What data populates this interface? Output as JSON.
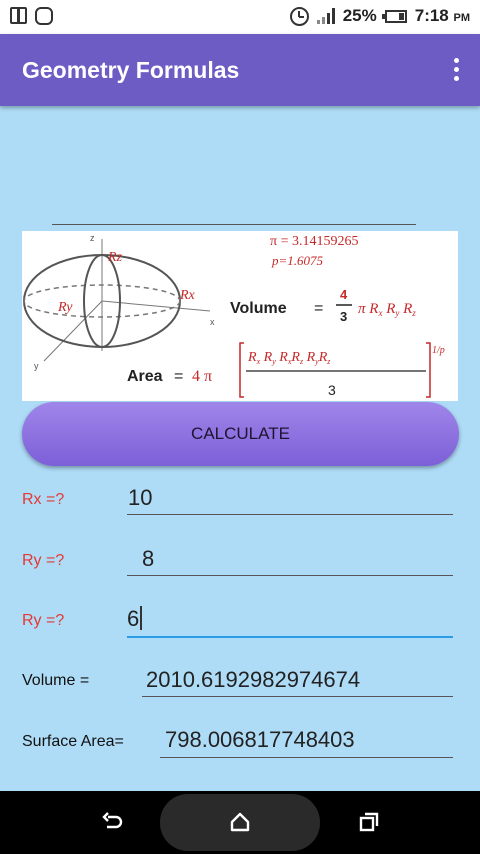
{
  "status_bar": {
    "battery_percent": "25%",
    "time": "7:18",
    "ampm": "PM"
  },
  "app_bar": {
    "title": "Geometry Formulas",
    "menu_icon": "more-vert-icon"
  },
  "formula_image": {
    "pi_line": "π = 3.14159265",
    "p_line": "p=1.6075",
    "labels": {
      "rz": "Rz",
      "rx": "Rx",
      "ry": "Ry",
      "z": "z",
      "x": "x",
      "y": "y"
    },
    "volume_label": "Volume",
    "area_label": "Area"
  },
  "calculate_label": "CALCULATE",
  "fields": [
    {
      "label": "Rx =?",
      "value": "10"
    },
    {
      "label": "Ry =?",
      "value": "8"
    },
    {
      "label": "Ry =?",
      "value": "6"
    }
  ],
  "results": {
    "volume_label": "Volume =",
    "volume_value": "2010.6192982974674",
    "area_label": "Surface Area=",
    "area_value": "798.006817748403"
  },
  "nav": {
    "back_icon": "back-icon",
    "home_icon": "home-icon",
    "recents_icon": "recents-icon"
  }
}
